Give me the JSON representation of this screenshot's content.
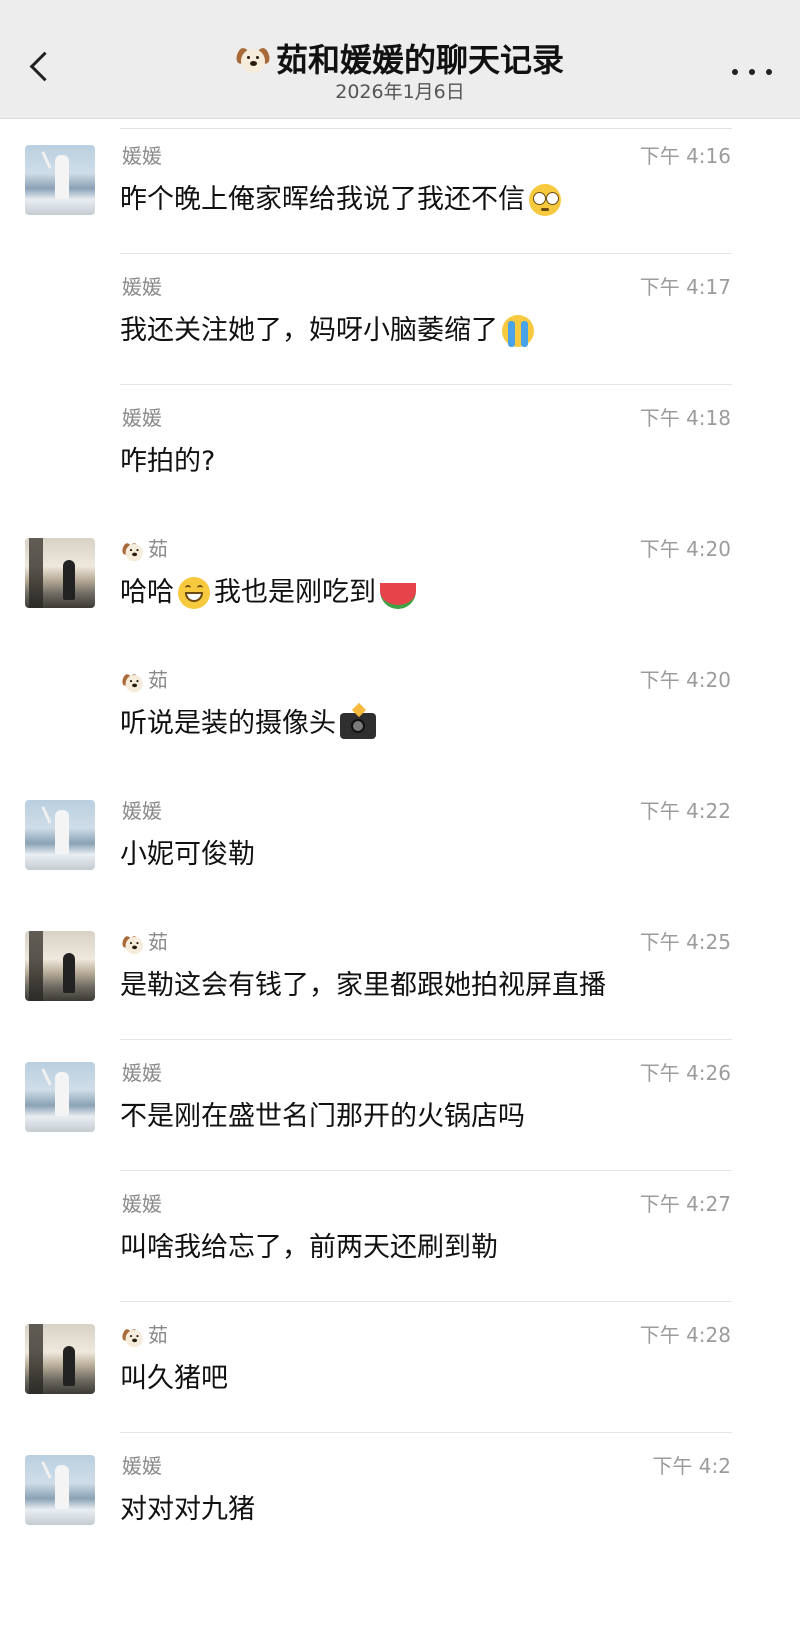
{
  "header": {
    "title": "茹和媛媛的聊天记录",
    "date": "2026年1月6日"
  },
  "messages": [
    {
      "sender": "媛媛",
      "time": "下午 4:16",
      "text": "昨个晚上俺家晖给我说了我还不信",
      "emoji_after": "flushed-face"
    },
    {
      "sender": "媛媛",
      "time": "下午 4:17",
      "text": "我还关注她了，妈呀小脑萎缩了",
      "emoji_after": "crying-face"
    },
    {
      "sender": "媛媛",
      "time": "下午 4:18",
      "text": "咋拍的?"
    },
    {
      "sender": "茹",
      "time": "下午 4:20",
      "text_before": "哈哈",
      "text_mid": "我也是刚吃到",
      "emoji_mid": "grinning-face",
      "emoji_after": "watermelon"
    },
    {
      "sender": "茹",
      "time": "下午 4:20",
      "text": "听说是装的摄像头",
      "emoji_after": "camera-with-flash"
    },
    {
      "sender": "媛媛",
      "time": "下午 4:22",
      "text": "小妮可俊勒"
    },
    {
      "sender": "茹",
      "time": "下午 4:25",
      "text": "是勒这会有钱了，家里都跟她拍视屏直播"
    },
    {
      "sender": "媛媛",
      "time": "下午 4:26",
      "text": "不是刚在盛世名门那开的火锅店吗"
    },
    {
      "sender": "媛媛",
      "time": "下午 4:27",
      "text": "叫啥我给忘了，前两天还刷到勒"
    },
    {
      "sender": "茹",
      "time": "下午 4:28",
      "text": "叫久猪吧"
    },
    {
      "sender": "媛媛",
      "time": "下午 4:2",
      "text": "对对对九猪"
    }
  ]
}
